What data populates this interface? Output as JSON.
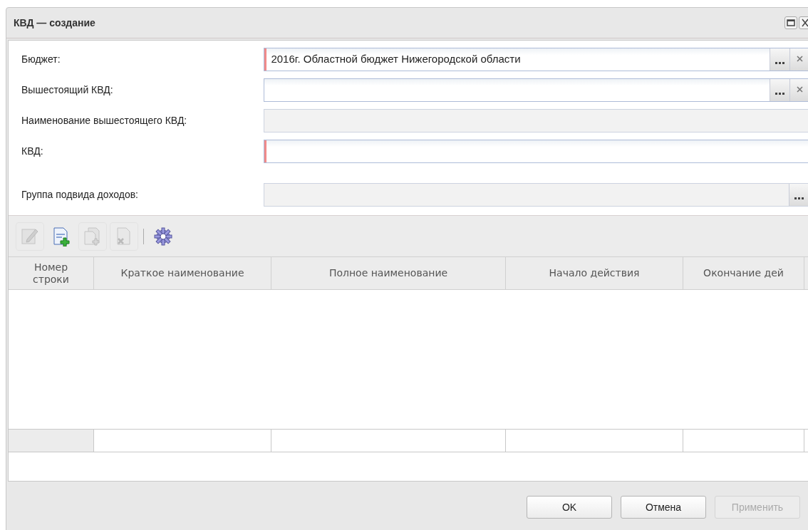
{
  "window": {
    "title": "КВД — создание"
  },
  "fields": [
    {
      "label": "Бюджет:",
      "value": "2016г. Областной бюджет Нижегородской области",
      "required": true,
      "readonly": false,
      "select_button": true,
      "clear_button": true
    },
    {
      "label": "Вышестоящий КВД:",
      "required": false,
      "readonly": false,
      "select_button": true,
      "clear_button": true
    },
    {
      "label": "Наименование вышестоящего КВД:",
      "required": false,
      "readonly": true,
      "select_button": false,
      "clear_button": false
    },
    {
      "label": "КВД:",
      "required": true,
      "readonly": false,
      "select_button": false,
      "clear_button": false
    },
    {
      "label": "Группа подвида доходов:",
      "required": false,
      "readonly": true,
      "select_button": true,
      "clear_button": false
    }
  ],
  "toolbar": [
    {
      "kind": "edit",
      "disabled": true
    },
    {
      "kind": "add",
      "disabled": false
    },
    {
      "kind": "copy",
      "disabled": true
    },
    {
      "kind": "delete",
      "disabled": true
    },
    {
      "kind": "settings",
      "disabled": false
    }
  ],
  "table": {
    "columns": [
      "Номер строки",
      "Краткое наименование",
      "Полное наименование",
      "Начало действия",
      "Окончание дей"
    ]
  },
  "buttons": [
    {
      "label": "OK",
      "disabled": false
    },
    {
      "label": "Отмена",
      "disabled": false
    },
    {
      "label": "Применить",
      "disabled": true
    }
  ]
}
